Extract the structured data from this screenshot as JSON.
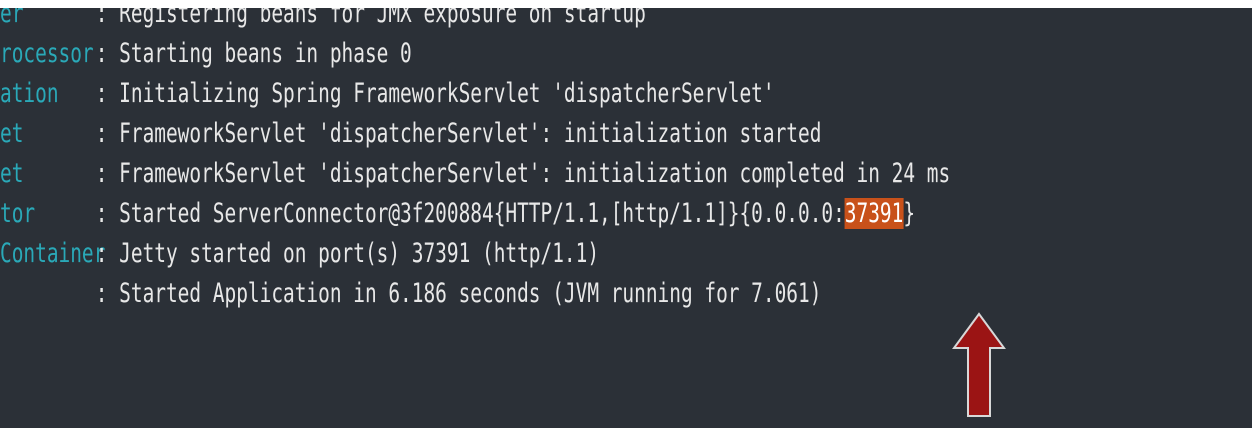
{
  "log": {
    "lines": [
      {
        "logger": "er",
        "message": ": Registering beans for JMX exposure on startup"
      },
      {
        "logger": "rocessor",
        "message": ": Starting beans in phase 0"
      },
      {
        "logger": "ation",
        "message": ": Initializing Spring FrameworkServlet 'dispatcherServlet'"
      },
      {
        "logger": "et",
        "message": ": FrameworkServlet 'dispatcherServlet': initialization started"
      },
      {
        "logger": "et",
        "message": ": FrameworkServlet 'dispatcherServlet': initialization completed in 24 ms"
      },
      {
        "logger": "tor",
        "message_before": ": Started ServerConnector@3f200884{HTTP/1.1,[http/1.1]}{0.0.0.0:",
        "highlight": "37391",
        "message_after": "}"
      },
      {
        "logger": "Container",
        "message": ": Jetty started on port(s) 37391 (http/1.1)"
      },
      {
        "logger": "",
        "message": ": Started Application in 6.186 seconds (JVM running for 7.061)"
      }
    ]
  },
  "colors": {
    "background": "#2b3037",
    "logger_text": "#2aa9b8",
    "message_text": "#e8e8e8",
    "highlight_background": "#c8511a",
    "arrow": "#9b1414"
  },
  "annotation": {
    "icon": "red-up-arrow-icon"
  }
}
